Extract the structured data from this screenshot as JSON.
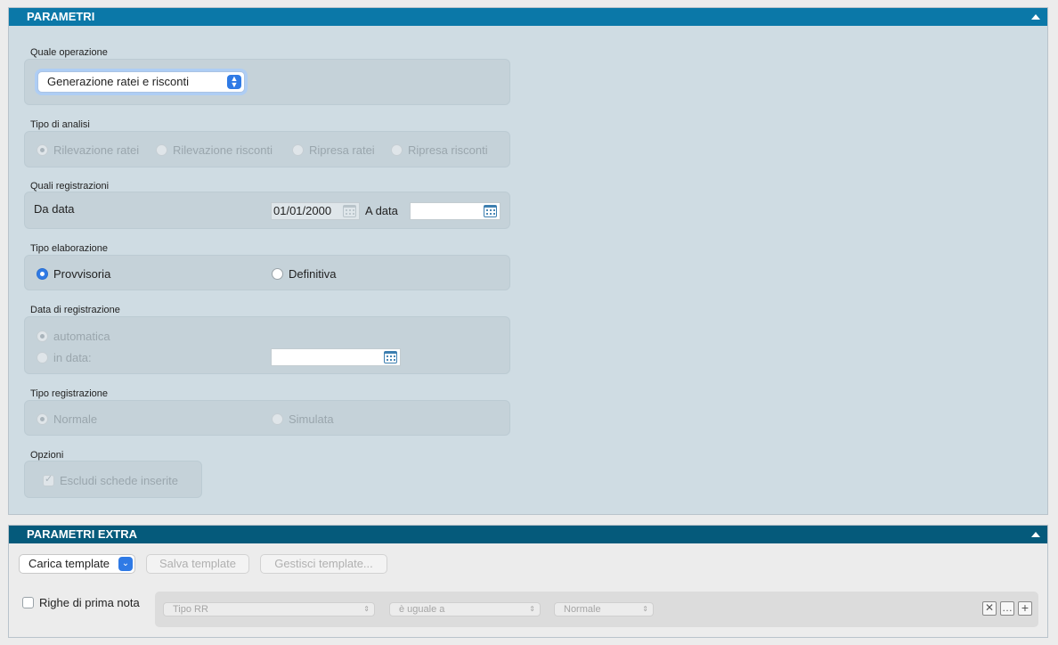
{
  "panel1": {
    "title": "PARAMETRI",
    "operazione": {
      "label": "Quale operazione",
      "selected": "Generazione ratei e risconti"
    },
    "tipo_analisi": {
      "label": "Tipo di analisi",
      "options": [
        "Rilevazione ratei",
        "Rilevazione risconti",
        "Ripresa ratei",
        "Ripresa risconti"
      ]
    },
    "registrazioni": {
      "label": "Quali registrazioni",
      "da_data_label": "Da data",
      "da_data_value": "01/01/2000",
      "a_data_label": "A data",
      "a_data_value": ""
    },
    "tipo_elaborazione": {
      "label": "Tipo elaborazione",
      "options": [
        "Provvisoria",
        "Definitiva"
      ]
    },
    "data_registrazione": {
      "label": "Data di registrazione",
      "option_auto": "automatica",
      "option_in_data": "in data:",
      "in_data_value": ""
    },
    "tipo_registrazione": {
      "label": "Tipo registrazione",
      "options": [
        "Normale",
        "Simulata"
      ]
    },
    "opzioni": {
      "label": "Opzioni",
      "escludi": "Escludi schede inserite"
    }
  },
  "panel2": {
    "title": "PARAMETRI EXTRA",
    "carica": "Carica template",
    "salva": "Salva template",
    "gestisci": "Gestisci template...",
    "righe_label": "Righe di prima nota",
    "filter": {
      "field": "Tipo RR",
      "operator": "è uguale a",
      "value": "Normale"
    }
  },
  "icons": [
    "collapse-arrow-icon",
    "calendar-icon",
    "popup-arrows-icon",
    "remove-icon",
    "more-icon",
    "add-icon"
  ]
}
